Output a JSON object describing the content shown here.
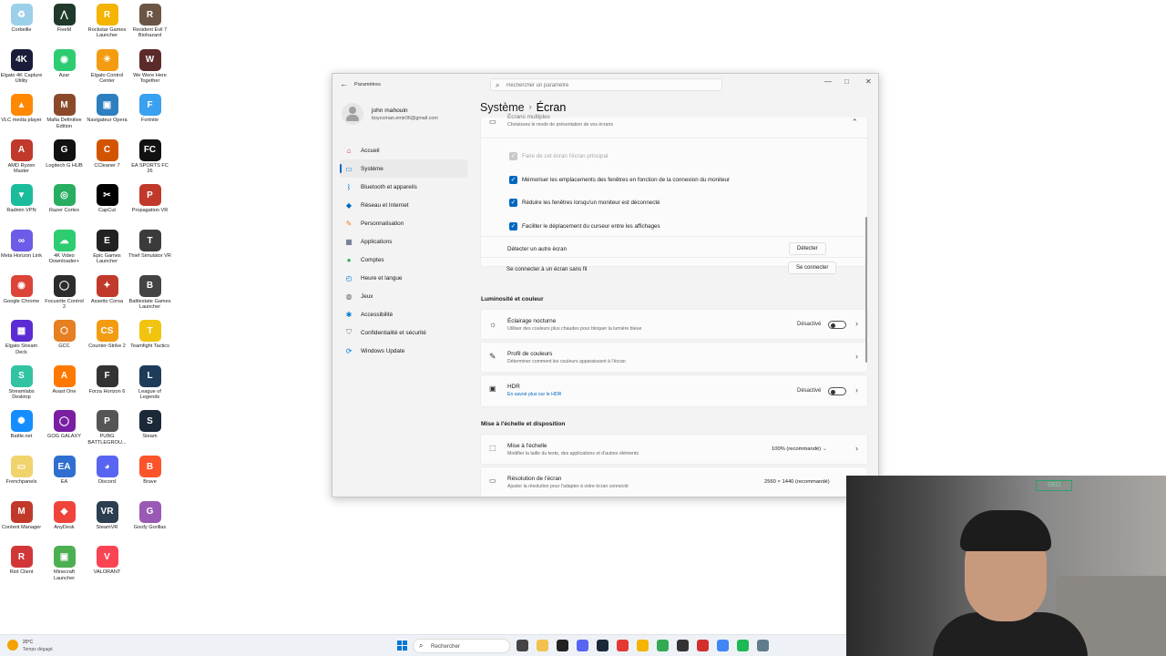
{
  "desktop": {
    "icons": [
      {
        "label": "Corbeille",
        "color": "#9ccfe8",
        "glyph": "♻"
      },
      {
        "label": "FiveM",
        "color": "#1f3a2a",
        "glyph": "⋀"
      },
      {
        "label": "Rockstar Games Launcher",
        "color": "#f4b400",
        "glyph": "R"
      },
      {
        "label": "Resident Evil 7 Biohazard",
        "color": "#6b5544",
        "glyph": "R"
      },
      {
        "label": "Elgato 4K Capture Utility",
        "color": "#1b1b3a",
        "glyph": "4K"
      },
      {
        "label": "Azar",
        "color": "#2ecc71",
        "glyph": "◉"
      },
      {
        "label": "Elgato Control Center",
        "color": "#f39c12",
        "glyph": "☀"
      },
      {
        "label": "We Were Here Together",
        "color": "#5b2a2a",
        "glyph": "W"
      },
      {
        "label": "VLC media player",
        "color": "#ff8800",
        "glyph": "▲"
      },
      {
        "label": "Mafia Definitive Edition",
        "color": "#8a4a2a",
        "glyph": "M"
      },
      {
        "label": "Navigateur Opera",
        "color": "#2d7fbf",
        "glyph": "▣"
      },
      {
        "label": "Fortnite",
        "color": "#3aa0f0",
        "glyph": "F"
      },
      {
        "label": "AMD Ryzen Master",
        "color": "#c0392b",
        "glyph": "A"
      },
      {
        "label": "Logitech G HUB",
        "color": "#111111",
        "glyph": "G"
      },
      {
        "label": "CCleaner 7",
        "color": "#d35400",
        "glyph": "C"
      },
      {
        "label": "EA SPORTS FC 26",
        "color": "#111111",
        "glyph": "FC"
      },
      {
        "label": "Radmin VPN",
        "color": "#1abc9c",
        "glyph": "▼"
      },
      {
        "label": "Razer Cortex",
        "color": "#27ae60",
        "glyph": "◎"
      },
      {
        "label": "CapCut",
        "color": "#000000",
        "glyph": "✂"
      },
      {
        "label": "Propagation VR",
        "color": "#c0392b",
        "glyph": "P"
      },
      {
        "label": "Meta Horizon Link",
        "color": "#6c5ce7",
        "glyph": "∞"
      },
      {
        "label": "4K Video Downloader+",
        "color": "#2ecc71",
        "glyph": "☁"
      },
      {
        "label": "Epic Games Launcher",
        "color": "#222222",
        "glyph": "E"
      },
      {
        "label": "Thief Simulator VR",
        "color": "#3b3b3b",
        "glyph": "T"
      },
      {
        "label": "Google Chrome",
        "color": "#db4437",
        "glyph": "◉"
      },
      {
        "label": "Focusrite Control 2",
        "color": "#2c2c2c",
        "glyph": "◯"
      },
      {
        "label": "Assetto Corsa",
        "color": "#c0392b",
        "glyph": "✦"
      },
      {
        "label": "Battlestate Games Launcher",
        "color": "#444444",
        "glyph": "B"
      },
      {
        "label": "Elgato Stream Deck",
        "color": "#5b2cd3",
        "glyph": "▦"
      },
      {
        "label": "GCC",
        "color": "#e67e22",
        "glyph": "⬡"
      },
      {
        "label": "Counter-Strike 2",
        "color": "#f39c12",
        "glyph": "CS"
      },
      {
        "label": "Teamfight Tactics",
        "color": "#f1c40f",
        "glyph": "T"
      },
      {
        "label": "Streamlabs Desktop",
        "color": "#31c3a2",
        "glyph": "S"
      },
      {
        "label": "Avast One",
        "color": "#ff7800",
        "glyph": "A"
      },
      {
        "label": "Forza Horizon 6",
        "color": "#333333",
        "glyph": "F"
      },
      {
        "label": "League of Legends",
        "color": "#1e3c5a",
        "glyph": "L"
      },
      {
        "label": "Battle.net",
        "color": "#148eff",
        "glyph": "✺"
      },
      {
        "label": "GOG GALAXY",
        "color": "#7a1fa2",
        "glyph": "◯"
      },
      {
        "label": "PUBG BATTLEGROU...",
        "color": "#555555",
        "glyph": "P"
      },
      {
        "label": "Steam",
        "color": "#1b2838",
        "glyph": "S"
      },
      {
        "label": "Frenchpanels",
        "color": "#f1d36b",
        "glyph": "▭"
      },
      {
        "label": "EA",
        "color": "#2f6fd0",
        "glyph": "EA"
      },
      {
        "label": "Discord",
        "color": "#5865f2",
        "glyph": "◕"
      },
      {
        "label": "Brave",
        "color": "#fb542b",
        "glyph": "B"
      },
      {
        "label": "Content Manager",
        "color": "#c0392b",
        "glyph": "M"
      },
      {
        "label": "AnyDesk",
        "color": "#ef443b",
        "glyph": "◆"
      },
      {
        "label": "SteamVR",
        "color": "#2c3e50",
        "glyph": "VR"
      },
      {
        "label": "Goofy Gorillas",
        "color": "#9b59b6",
        "glyph": "G"
      },
      {
        "label": "Riot Client",
        "color": "#d13639",
        "glyph": "R"
      },
      {
        "label": "Minecraft Launcher",
        "color": "#4caf50",
        "glyph": "▣"
      },
      {
        "label": "VALORANT",
        "color": "#fa4454",
        "glyph": "V"
      }
    ]
  },
  "window": {
    "app_title": "Paramètres",
    "search_placeholder": "Rechercher un paramètre",
    "controls": {
      "minimize": "—",
      "maximize": "□",
      "close": "✕"
    },
    "back_glyph": "←"
  },
  "profile": {
    "name": "john mahouin",
    "email": "boycoman.emir06@gmail.com"
  },
  "nav": [
    {
      "label": "Accueil",
      "icon": "home-icon",
      "glyph": "⌂",
      "color": "#c0392b",
      "active": false
    },
    {
      "label": "Système",
      "icon": "system-icon",
      "glyph": "▭",
      "color": "#0078d4",
      "active": true
    },
    {
      "label": "Bluetooth et appareils",
      "icon": "bluetooth-icon",
      "glyph": "ᛒ",
      "color": "#0078d4",
      "active": false
    },
    {
      "label": "Réseau et Internet",
      "icon": "network-icon",
      "glyph": "◆",
      "color": "#0067c0",
      "active": false
    },
    {
      "label": "Personnalisation",
      "icon": "brush-icon",
      "glyph": "✎",
      "color": "#e67e22",
      "active": false
    },
    {
      "label": "Applications",
      "icon": "apps-icon",
      "glyph": "▦",
      "color": "#4a5a7a",
      "active": false
    },
    {
      "label": "Comptes",
      "icon": "accounts-icon",
      "glyph": "●",
      "color": "#27ae60",
      "active": false
    },
    {
      "label": "Heure et langue",
      "icon": "time-language-icon",
      "glyph": "◴",
      "color": "#0078d4",
      "active": false
    },
    {
      "label": "Jeux",
      "icon": "games-icon",
      "glyph": "◍",
      "color": "#666666",
      "active": false
    },
    {
      "label": "Accessibilité",
      "icon": "accessibility-icon",
      "glyph": "✱",
      "color": "#0078d4",
      "active": false
    },
    {
      "label": "Confidentialité et sécurité",
      "icon": "shield-icon",
      "glyph": "⛉",
      "color": "#777777",
      "active": false
    },
    {
      "label": "Windows Update",
      "icon": "update-icon",
      "glyph": "⟳",
      "color": "#0078d4",
      "active": false
    }
  ],
  "header": {
    "parent": "Système",
    "separator": "›",
    "current": "Écran"
  },
  "multi_display": {
    "title": "Écrans multiples",
    "subtitle": "Choisissez le mode de présentation de vos écrans",
    "collapse_glyph": "⌃",
    "options": [
      {
        "label": "Faire de cet écran l'écran principal",
        "checked": true,
        "disabled": true
      },
      {
        "label": "Mémoriser les emplacements des fenêtres en fonction de la connexion du moniteur",
        "checked": true,
        "disabled": false
      },
      {
        "label": "Réduire les fenêtres lorsqu'un moniteur est déconnecté",
        "checked": true,
        "disabled": false
      },
      {
        "label": "Faciliter le déplacement du curseur entre les affichages",
        "checked": true,
        "disabled": false
      }
    ],
    "detect_label": "Détecter un autre écran",
    "detect_button": "Détecter",
    "wireless_label": "Se connecter à un écran sans fil",
    "wireless_button": "Se connecter"
  },
  "brightness_section": {
    "title": "Luminosité et couleur",
    "night_light": {
      "title": "Éclairage nocturne",
      "subtitle": "Utiliser des couleurs plus chaudes pour bloquer la lumière bleue",
      "status": "Désactivé",
      "on": false
    },
    "color_profile": {
      "title": "Profil de couleurs",
      "subtitle": "Déterminer comment les couleurs apparaissent à l'écran"
    },
    "hdr": {
      "title": "HDR",
      "subtitle": "En savoir plus sur le HDR",
      "status": "Désactivé",
      "on": false
    }
  },
  "scale_section": {
    "title": "Mise à l'échelle et disposition",
    "scale": {
      "title": "Mise à l'échelle",
      "subtitle": "Modifier la taille du texte, des applications et d'autres éléments",
      "value": "100% (recommandé)"
    },
    "resolution": {
      "title": "Résolution de l'écran",
      "subtitle": "Ajuster la résolution pour l'adapter à votre écran connecté",
      "value": "2560 × 1440 (recommandé)"
    }
  },
  "webcam": {
    "sign_text": "SEO"
  },
  "taskbar": {
    "weather_temp": "20°C",
    "weather_cond": "Temps dégagé",
    "search_label": "Rechercher",
    "apps": [
      {
        "name": "task-view-icon",
        "color": "#444444"
      },
      {
        "name": "file-explorer-icon",
        "color": "#f2c14e"
      },
      {
        "name": "terminal-icon",
        "color": "#222222"
      },
      {
        "name": "discord-taskbar-icon",
        "color": "#5865f2"
      },
      {
        "name": "steam-taskbar-icon",
        "color": "#1b2838"
      },
      {
        "name": "record-taskbar-icon",
        "color": "#e53935"
      },
      {
        "name": "rockstar-taskbar-icon",
        "color": "#f4b400"
      },
      {
        "name": "chrome-taskbar-icon",
        "color": "#34a853"
      },
      {
        "name": "obs-taskbar-icon",
        "color": "#333333"
      },
      {
        "name": "opera-taskbar-icon",
        "color": "#d32f2f"
      },
      {
        "name": "chrome2-taskbar-icon",
        "color": "#4285f4"
      },
      {
        "name": "spotify-taskbar-icon",
        "color": "#1db954"
      },
      {
        "name": "settings-taskbar-icon",
        "color": "#607d8b"
      }
    ]
  },
  "colors": {
    "accent": "#0067c0"
  }
}
